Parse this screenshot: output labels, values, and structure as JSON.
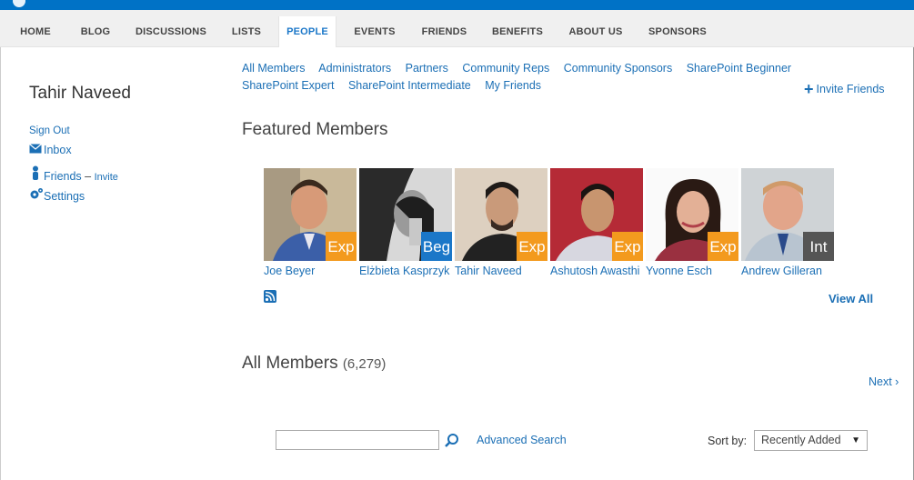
{
  "nav": {
    "items": [
      {
        "label": "HOME"
      },
      {
        "label": "BLOG"
      },
      {
        "label": "DISCUSSIONS"
      },
      {
        "label": "LISTS"
      },
      {
        "label": "PEOPLE",
        "active": true
      },
      {
        "label": "EVENTS"
      },
      {
        "label": "FRIENDS"
      },
      {
        "label": "BENEFITS"
      },
      {
        "label": "ABOUT US"
      },
      {
        "label": "SPONSORS"
      }
    ]
  },
  "sidebar": {
    "username": "Tahir Naveed",
    "sign_out": "Sign Out",
    "inbox": "Inbox",
    "friends": "Friends",
    "friends_sep": "–",
    "invite": "Invite",
    "settings": "Settings"
  },
  "filters": {
    "row1": [
      "All Members",
      "Administrators",
      "Partners",
      "Community Reps",
      "Community Sponsors",
      "SharePoint Beginner"
    ],
    "row2": [
      "SharePoint Expert",
      "SharePoint Intermediate",
      "My Friends"
    ]
  },
  "invite_friends": "Invite Friends",
  "featured": {
    "title": "Featured Members",
    "members": [
      {
        "name": "Joe Beyer",
        "badge": "Exp",
        "badge_color": "#f39a1e"
      },
      {
        "name": "Elżbieta Kasprzyk",
        "badge": "Beg",
        "badge_color": "#1b77c8"
      },
      {
        "name": "Tahir Naveed",
        "badge": "Exp",
        "badge_color": "#f39a1e"
      },
      {
        "name": "Ashutosh Awasthi",
        "badge": "Exp",
        "badge_color": "#f39a1e"
      },
      {
        "name": "Yvonne Esch",
        "badge": "Exp",
        "badge_color": "#f39a1e"
      },
      {
        "name": "Andrew Gilleran",
        "badge": "Int",
        "badge_color": "#555555"
      }
    ],
    "view_all": "View All"
  },
  "all_members": {
    "title": "All Members",
    "count": "(6,279)",
    "next": "Next ›"
  },
  "search": {
    "value": "",
    "advanced": "Advanced Search"
  },
  "sort": {
    "label": "Sort by:",
    "selected": "Recently Added"
  },
  "colors": {
    "accent": "#1b6fb5",
    "topbar": "#0072c6",
    "nav_bg": "#f0f0f0"
  }
}
